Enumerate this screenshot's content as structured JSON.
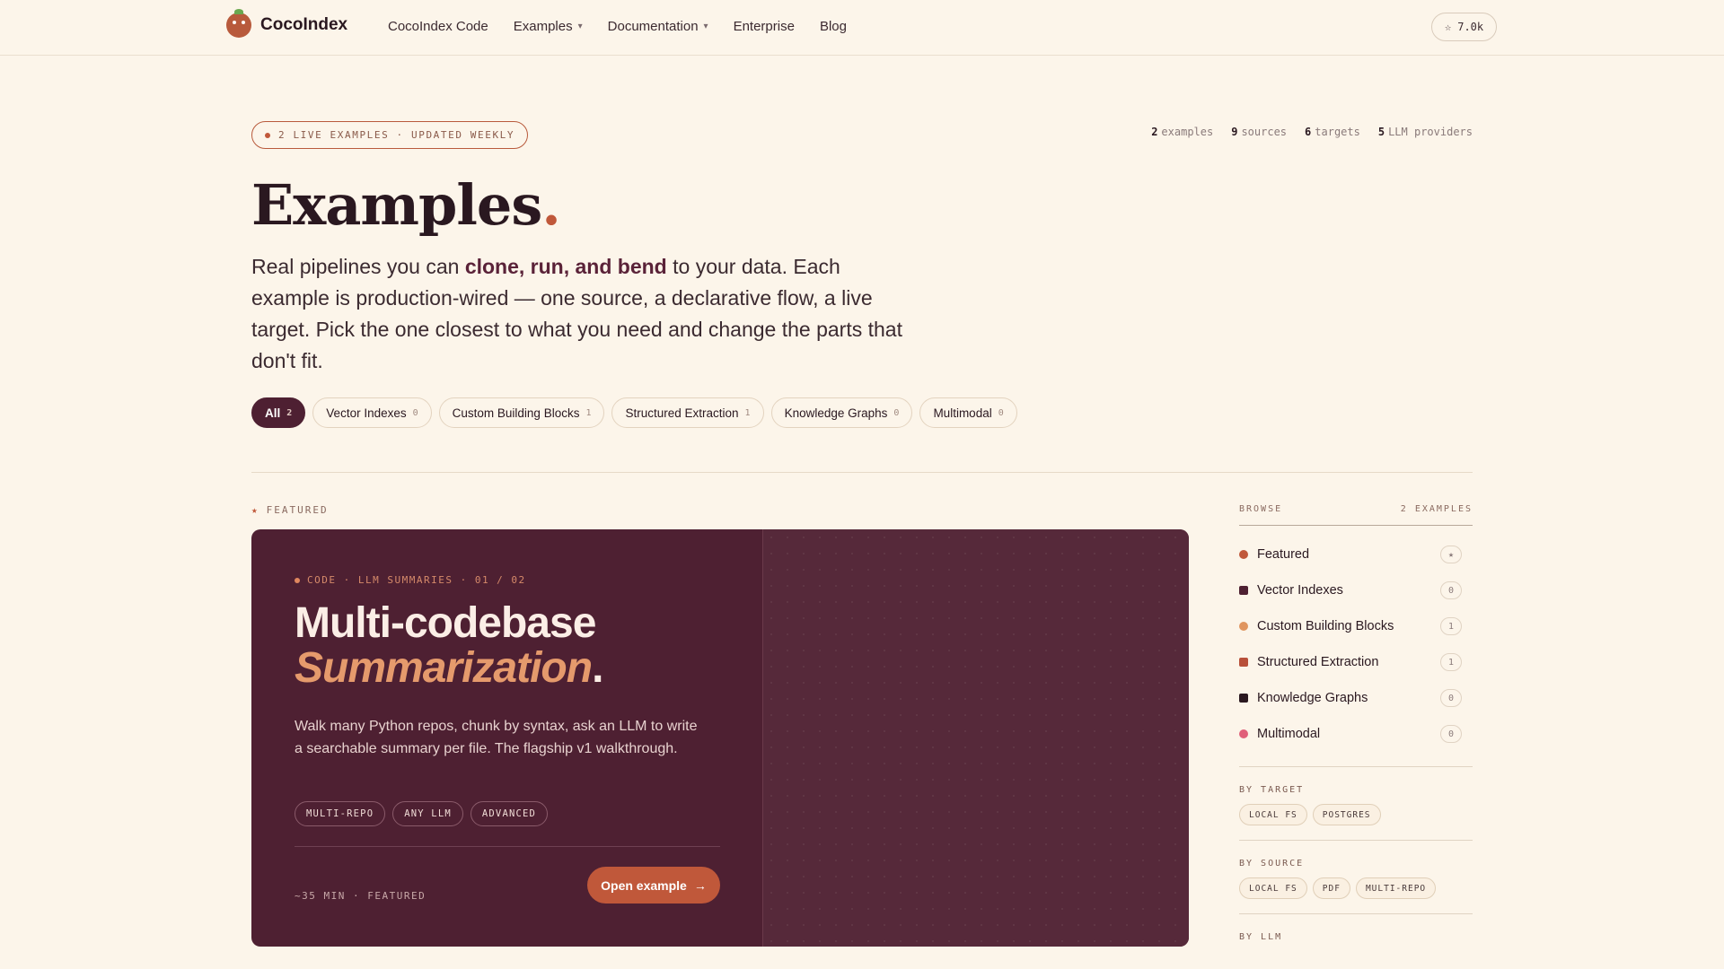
{
  "nav": {
    "brand": "CocoIndex",
    "links": [
      {
        "label": "CocoIndex Code",
        "has_menu": false
      },
      {
        "label": "Examples",
        "has_menu": true
      },
      {
        "label": "Documentation",
        "has_menu": true
      },
      {
        "label": "Enterprise",
        "has_menu": false
      },
      {
        "label": "Blog",
        "has_menu": false
      }
    ],
    "stars": "7.0k"
  },
  "hero": {
    "badge": "2 LIVE EXAMPLES · UPDATED WEEKLY",
    "stats": [
      {
        "value": "2",
        "label": "examples"
      },
      {
        "value": "9",
        "label": "sources"
      },
      {
        "value": "6",
        "label": "targets"
      },
      {
        "value": "5",
        "label": "LLM providers"
      }
    ],
    "title": "Examples",
    "title_period": ".",
    "lede_before": "Real pipelines you can ",
    "lede_strong": "clone, run, and bend",
    "lede_after": " to your data. Each example is production-wired — one source, a declarative flow, a live target. Pick the one closest to what you need and change the parts that don't fit."
  },
  "filters": [
    {
      "label": "All",
      "count": "2",
      "active": true
    },
    {
      "label": "Vector Indexes",
      "count": "0",
      "active": false
    },
    {
      "label": "Custom Building Blocks",
      "count": "1",
      "active": false
    },
    {
      "label": "Structured Extraction",
      "count": "1",
      "active": false
    },
    {
      "label": "Knowledge Graphs",
      "count": "0",
      "active": false
    },
    {
      "label": "Multimodal",
      "count": "0",
      "active": false
    }
  ],
  "featured": {
    "section_label": "FEATURED",
    "meta": "CODE · LLM SUMMARIES · 01 / 02",
    "title_line1": "Multi-codebase",
    "title_line2": "Summarization",
    "title_period": ".",
    "description": "Walk many Python repos, chunk by syntax, ask an LLM to write a searchable summary per file. The flagship v1 walkthrough.",
    "tags": [
      "MULTI-REPO",
      "ANY LLM",
      "ADVANCED"
    ],
    "footer": "~35 MIN · FEATURED",
    "cta": "Open example"
  },
  "sidebar": {
    "heading": "BROWSE",
    "heading_count": "2 EXAMPLES",
    "items": [
      {
        "label": "Featured",
        "count": "★",
        "color": "#c0583a",
        "shape": "circle"
      },
      {
        "label": "Vector Indexes",
        "count": "0",
        "color": "#4e2032",
        "shape": "square"
      },
      {
        "label": "Custom Building Blocks",
        "count": "1",
        "color": "#e0955f",
        "shape": "circle"
      },
      {
        "label": "Structured Extraction",
        "count": "1",
        "color": "#b8503a",
        "shape": "square"
      },
      {
        "label": "Knowledge Graphs",
        "count": "0",
        "color": "#2a1820",
        "shape": "square"
      },
      {
        "label": "Multimodal",
        "count": "0",
        "color": "#e0607a",
        "shape": "circle"
      }
    ],
    "by_target_title": "BY TARGET",
    "by_target": [
      "LOCAL FS",
      "POSTGRES"
    ],
    "by_source_title": "BY SOURCE",
    "by_source": [
      "LOCAL FS",
      "PDF",
      "MULTI-REPO"
    ],
    "by_llm_title": "BY LLM"
  }
}
